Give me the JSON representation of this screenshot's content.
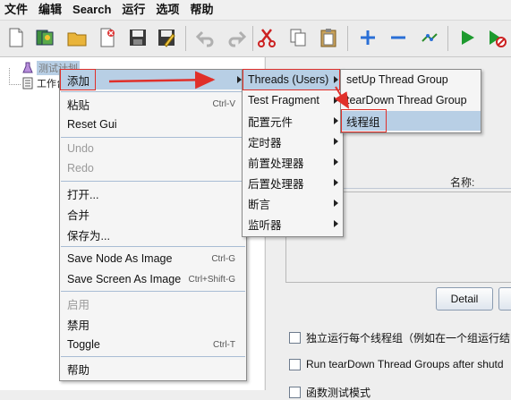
{
  "menubar": [
    "文件",
    "编辑",
    "Search",
    "运行",
    "选项",
    "帮助"
  ],
  "toolbar": [
    "new-file-icon",
    "templates-icon",
    "open-folder-icon",
    "close-file-icon",
    "save-icon",
    "save-as-icon",
    "undo-icon",
    "redo-icon",
    "cut-icon",
    "copy-icon",
    "paste-icon",
    "expand-icon",
    "collapse-icon",
    "toggle-icon",
    "start-icon",
    "start-no-pause-icon"
  ],
  "tree": {
    "root_label": "测试计划",
    "child_label": "工作台"
  },
  "context_menu": {
    "items": [
      {
        "label": "添加",
        "shortcut": "",
        "disabled": false,
        "submenu": true,
        "selected": true
      },
      {
        "label": "粘贴",
        "shortcut": "Ctrl-V",
        "disabled": false
      },
      {
        "label": "Reset Gui",
        "shortcut": "",
        "disabled": false
      },
      {
        "label": "Undo",
        "shortcut": "",
        "disabled": true
      },
      {
        "label": "Redo",
        "shortcut": "",
        "disabled": true
      },
      {
        "label": "打开...",
        "shortcut": "",
        "disabled": false
      },
      {
        "label": "合并",
        "shortcut": "",
        "disabled": false
      },
      {
        "label": "保存为...",
        "shortcut": "",
        "disabled": false
      },
      {
        "label": "Save Node As Image",
        "shortcut": "Ctrl-G",
        "disabled": false
      },
      {
        "label": "Save Screen As Image",
        "shortcut": "Ctrl+Shift-G",
        "disabled": false
      },
      {
        "label": "启用",
        "shortcut": "",
        "disabled": true
      },
      {
        "label": "禁用",
        "shortcut": "",
        "disabled": false
      },
      {
        "label": "Toggle",
        "shortcut": "Ctrl-T",
        "disabled": false
      },
      {
        "label": "帮助",
        "shortcut": "",
        "disabled": false
      }
    ]
  },
  "add_submenu": {
    "items": [
      {
        "label": "Threads (Users)",
        "selected": true
      },
      {
        "label": "Test Fragment"
      },
      {
        "label": "配置元件"
      },
      {
        "label": "定时器"
      },
      {
        "label": "前置处理器"
      },
      {
        "label": "后置处理器"
      },
      {
        "label": "断言"
      },
      {
        "label": "监听器"
      }
    ]
  },
  "threads_submenu": {
    "items": [
      {
        "label": "setUp Thread Group"
      },
      {
        "label": "tearDown Thread Group"
      },
      {
        "label": "线程组",
        "selected": true
      }
    ]
  },
  "right_panel": {
    "name_label": "名称:",
    "detail_button": "Detail",
    "checkbox_1": "独立运行每个线程组（例如在一个组运行结",
    "checkbox_2": "Run tearDown Thread Groups after shutd",
    "checkbox_3": "函数测试模式"
  },
  "colors": {
    "annotation_red": "#e0302a",
    "selection": "#b8cfe5"
  }
}
